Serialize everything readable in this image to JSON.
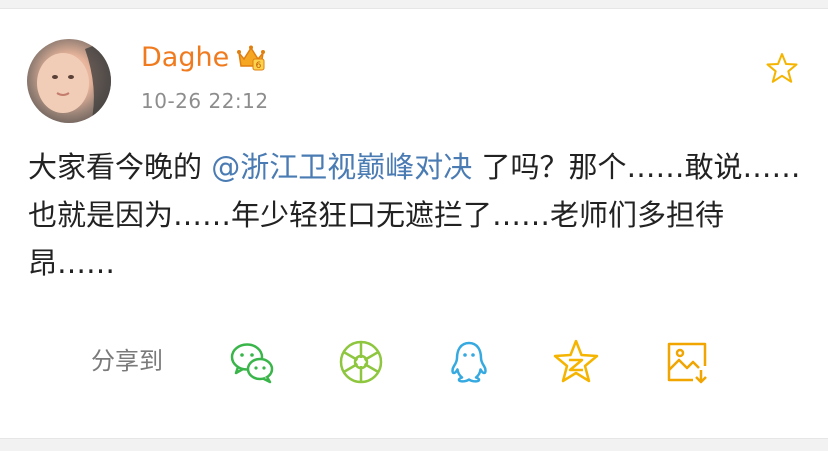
{
  "post": {
    "username": "Daghe",
    "timestamp": "10-26 22:12",
    "body_before": "大家看今晚的 ",
    "mention": "@浙江卫视巅峰对决",
    "body_after": " 了吗？那个……敢说……也就是因为……年少轻狂口无遮拦了……老师们多担待昂……"
  },
  "share": {
    "label": "分享到",
    "targets": [
      {
        "icon": "wechat-icon",
        "color": "#39b54a"
      },
      {
        "icon": "moments-icon",
        "color": "#8ec63f"
      },
      {
        "icon": "qq-icon",
        "color": "#35a9e0"
      },
      {
        "icon": "qzone-icon",
        "color": "#f5b400"
      },
      {
        "icon": "save-image-icon",
        "color": "#f0a500"
      }
    ]
  },
  "colors": {
    "username": "#f07b1f",
    "mention": "#4a7bb3",
    "favorite_star": "#f5b400"
  }
}
